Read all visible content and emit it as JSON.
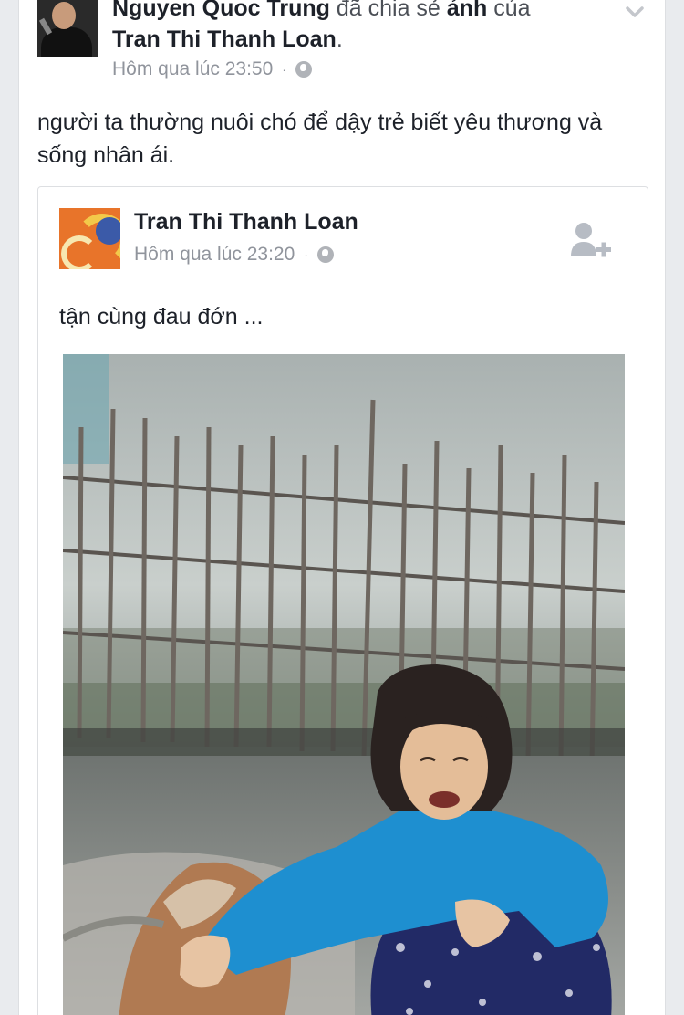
{
  "post": {
    "author": "Nguyen Quoc Trung",
    "share_verb": "đã chia sẻ",
    "share_object": "ảnh",
    "share_of": "của",
    "original_author": "Tran Thi Thanh Loan",
    "period": ".",
    "timestamp": "Hôm qua lúc 23:50",
    "separator": "·",
    "caption": "người ta thường nuôi chó để dậy trẻ biết yêu thương và sống nhân ái."
  },
  "shared_post": {
    "author": "Tran Thi Thanh Loan",
    "timestamp": "Hôm qua lúc 23:20",
    "separator": "·",
    "text": "tận cùng đau đớn ..."
  },
  "icons": {
    "chevron": "chevron-down-icon",
    "privacy": "globe-icon",
    "add_friend": "add-friend-icon"
  },
  "colors": {
    "background": "#e9ebee",
    "card": "#ffffff",
    "meta_text": "#90949c",
    "primary_text": "#1d2129",
    "child_sweater": "#1e8fd0"
  }
}
